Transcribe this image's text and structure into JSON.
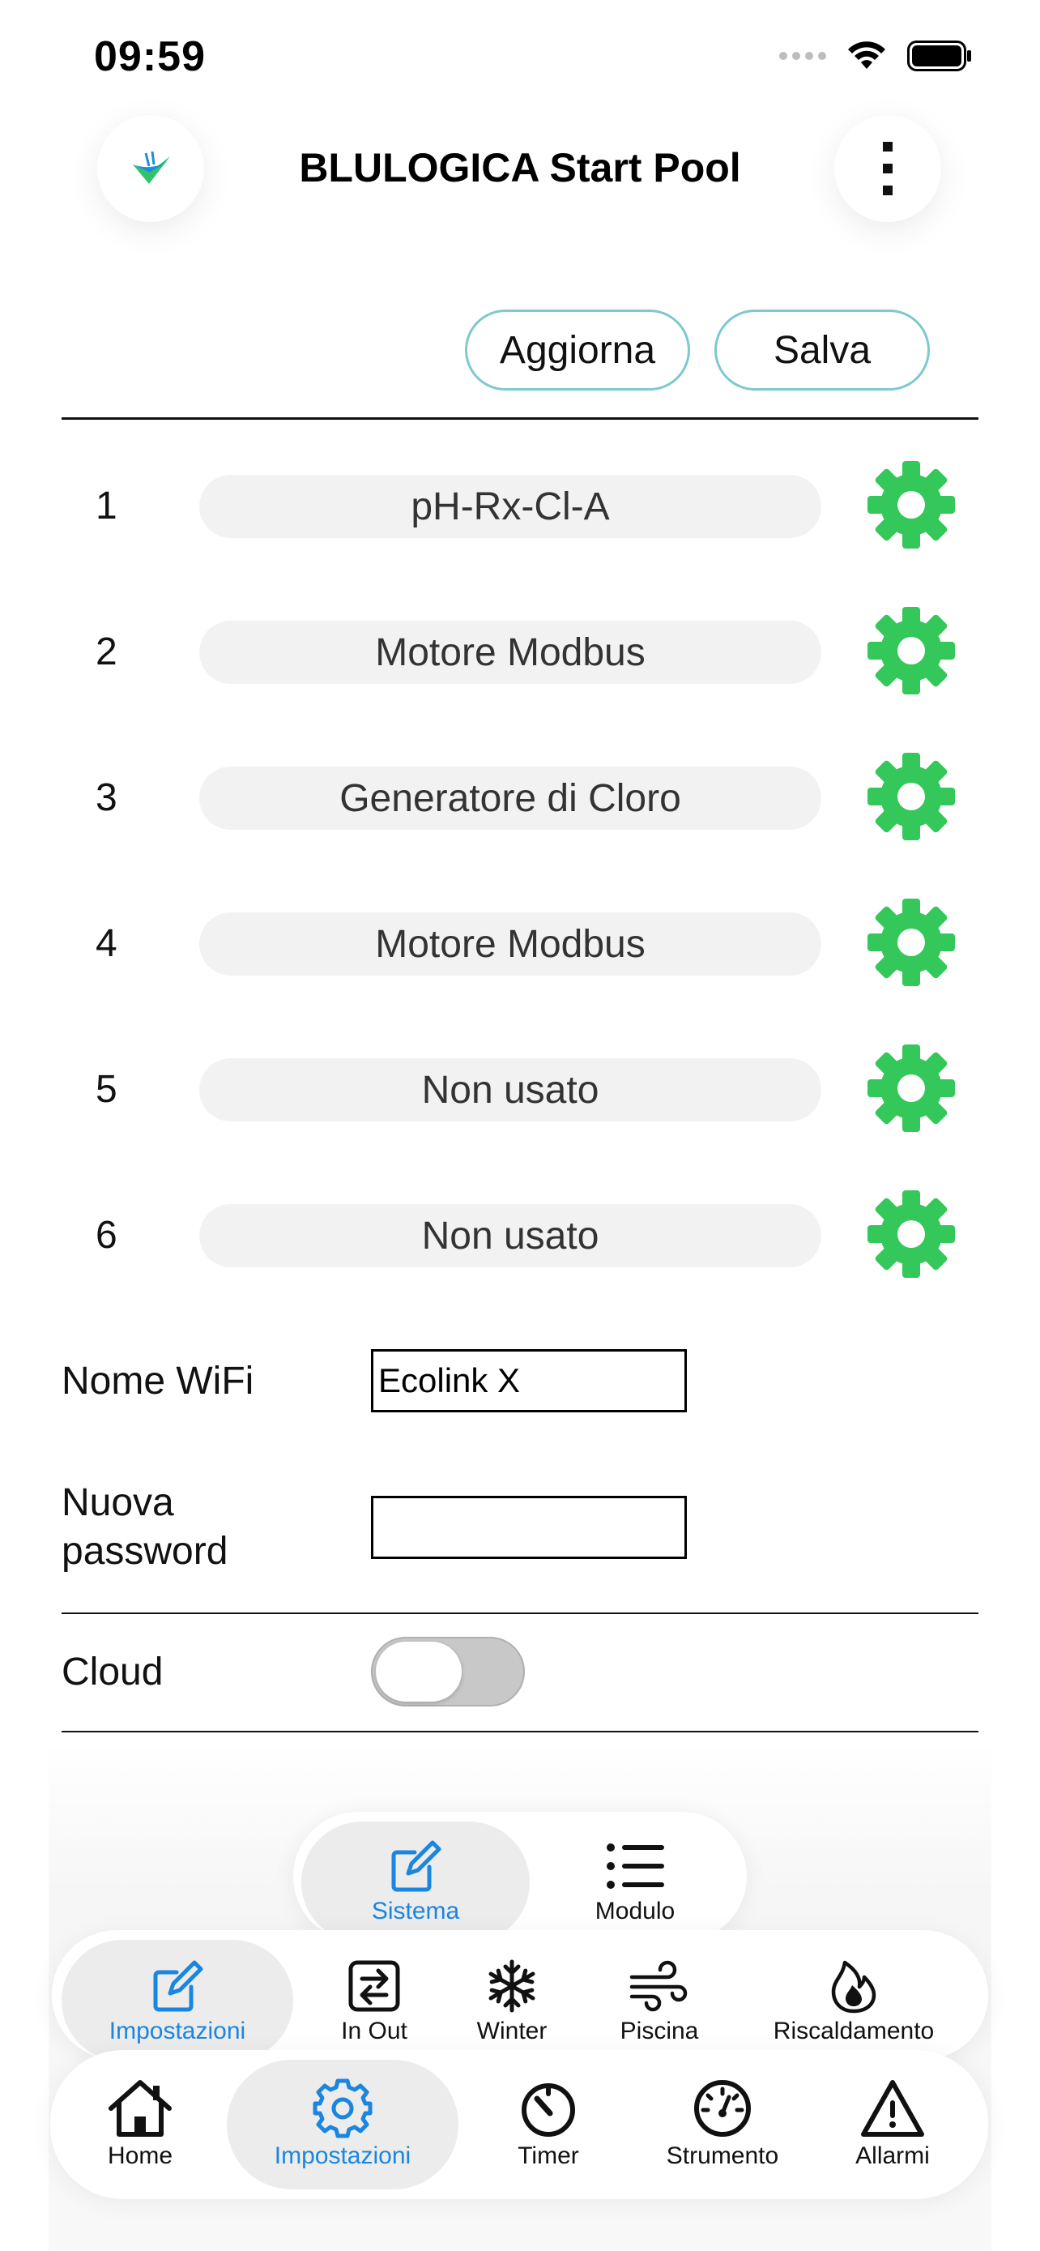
{
  "status_bar": {
    "time": "09:59"
  },
  "header": {
    "title": "BLULOGICA Start Pool"
  },
  "toolbar": {
    "refresh_label": "Aggiorna",
    "save_label": "Salva"
  },
  "modules": [
    {
      "number": "1",
      "name": "pH-Rx-Cl-A"
    },
    {
      "number": "2",
      "name": "Motore Modbus"
    },
    {
      "number": "3",
      "name": "Generatore di Cloro"
    },
    {
      "number": "4",
      "name": "Motore Modbus"
    },
    {
      "number": "5",
      "name": "Non usato"
    },
    {
      "number": "6",
      "name": "Non usato"
    }
  ],
  "form": {
    "wifi_label": "Nome WiFi",
    "wifi_value": "Ecolink X",
    "password_label_line1": "Nuova",
    "password_label_line2": "password",
    "password_value": "",
    "cloud_label": "Cloud",
    "cloud_enabled": false
  },
  "colors": {
    "accent": "#1a86e0",
    "gear": "#34c759",
    "button_border": "#7cc9cf"
  },
  "subtabs": [
    {
      "label": "Sistema",
      "icon": "edit-icon",
      "active": true
    },
    {
      "label": "Modulo",
      "icon": "list-icon",
      "active": false
    }
  ],
  "settings_tabs": [
    {
      "label": "Impostazioni",
      "icon": "edit-icon",
      "active": true
    },
    {
      "label": "In Out",
      "icon": "in-out-icon",
      "active": false
    },
    {
      "label": "Winter",
      "icon": "snowflake-icon",
      "active": false
    },
    {
      "label": "Piscina",
      "icon": "wind-icon",
      "active": false
    },
    {
      "label": "Riscaldamento",
      "icon": "flame-icon",
      "active": false
    }
  ],
  "main_tabs": [
    {
      "label": "Home",
      "icon": "home-icon",
      "active": false
    },
    {
      "label": "Impostazioni",
      "icon": "gear-icon",
      "active": true
    },
    {
      "label": "Timer",
      "icon": "timer-icon",
      "active": false
    },
    {
      "label": "Strumento",
      "icon": "gauge-icon",
      "active": false
    },
    {
      "label": "Allarmi",
      "icon": "warning-icon",
      "active": false
    }
  ]
}
